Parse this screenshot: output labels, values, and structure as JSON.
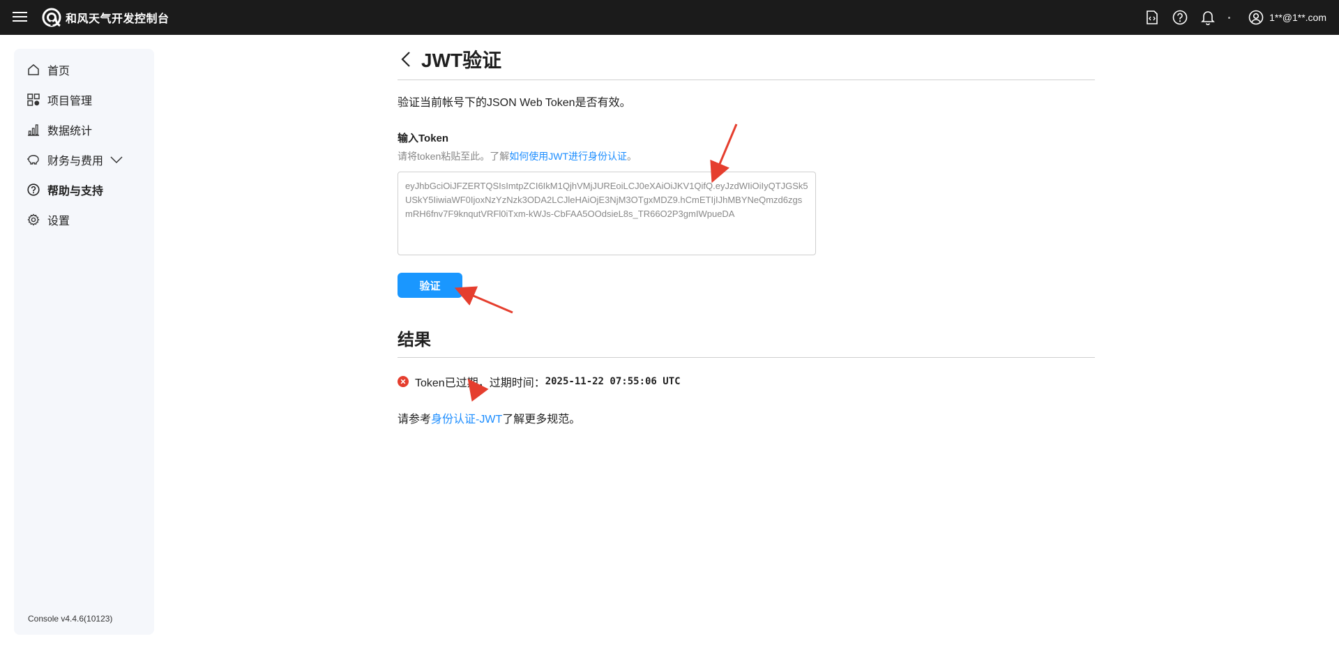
{
  "header": {
    "logo_text": "和风天气开发控制台",
    "user_name": "1**@1**.com",
    "icons": [
      "menu-icon",
      "document-code-icon",
      "help-icon",
      "bell-icon",
      "user-icon"
    ]
  },
  "sidebar": {
    "items": [
      {
        "label": "首页",
        "icon": "home-icon"
      },
      {
        "label": "项目管理",
        "icon": "grid-icon"
      },
      {
        "label": "数据统计",
        "icon": "bar-chart-icon"
      },
      {
        "label": "财务与费用",
        "icon": "piggy-bank-icon"
      },
      {
        "label": "帮助与支持",
        "icon": "help-icon"
      },
      {
        "label": "设置",
        "icon": "gear-icon"
      }
    ],
    "version": "Console v4.4.6(10123)"
  },
  "main": {
    "title": "JWT验证",
    "description": "验证当前帐号下的JSON Web Token是否有效。",
    "input_label": "输入Token",
    "hint_prefix": "请将token粘贴至此。了解",
    "hint_link": "如何使用JWT进行身份认证",
    "hint_suffix": "。",
    "token_value": "eyJhbGciOiJFZERTQSIsImtpZCI6IkM1QjhVMjJUREoiLCJ0eXAiOiJKV1QifQ.eyJzdWIiOiIyQTJGSk5USkY5IiwiaWF0IjoxNzYzNzk3ODA2LCJleHAiOjE3NjM3OTgxMDZ9.hCmETIjIJhMBYNeQmzd6zgsmRH6fnv7F9knqutVRFl0iTxm-kWJs-CbFAA5OOdsieL8s_TR66O2P3gmIWpueDA",
    "verify_button": "验证",
    "result_title": "结果",
    "result_status": "Token已过期，过期时间：",
    "result_time": "2025-11-22 07:55:06 UTC",
    "ref_prefix": "请参考",
    "ref_link": "身份认证-JWT",
    "ref_suffix": "了解更多规范。"
  },
  "colors": {
    "topbar": "#1b1b1b",
    "sidebar_bg": "#f5f7fb",
    "accent": "#1a97ff",
    "link": "#1a8cff",
    "error": "#e53e2e",
    "annotation_arrow": "#e53e2e"
  }
}
